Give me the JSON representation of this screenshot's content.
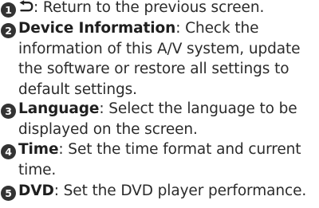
{
  "items": [
    {
      "number": "1",
      "icon": "back-arrow-icon",
      "separator": ":",
      "line1": " Return to the previous screen."
    },
    {
      "number": "2",
      "term": "Device Information",
      "separator": ":",
      "line1": " Check the",
      "continuation": "information of this A/V system, update the software or restore all settings to default settings."
    },
    {
      "number": "3",
      "term": "Language",
      "separator": ":",
      "line1": " Select the language to be",
      "continuation": "displayed on the screen."
    },
    {
      "number": "4",
      "term": "Time",
      "separator": ":",
      "line1": " Set the time format and current",
      "continuation": "time."
    },
    {
      "number": "5",
      "term": "DVD",
      "separator": ":",
      "line1": " Set the DVD player performance."
    }
  ],
  "colors": {
    "badge": "#333333",
    "text": "#2b2b2b"
  }
}
